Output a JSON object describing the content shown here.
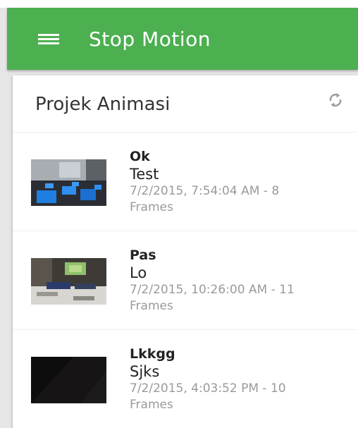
{
  "colors": {
    "app_bar": "#4caf50",
    "meta_text": "#9a9a9a",
    "icon": "#9e9e9e"
  },
  "app_bar": {
    "menu_icon": "hamburger-menu-icon",
    "title": "Stop Motion"
  },
  "card": {
    "title": "Projek Animasi",
    "refresh_icon": "refresh-icon"
  },
  "projects": [
    {
      "name": "Ok",
      "description": "Test",
      "meta_line1": "7/2/2015, 7:54:04 AM - 8",
      "meta_line2": "Frames",
      "thumbnail": "classroom-computers"
    },
    {
      "name": "Pas",
      "description": "Lo",
      "meta_line1": "7/2/2015, 10:26:00 AM - 11",
      "meta_line2": "Frames",
      "thumbnail": "classroom-projector"
    },
    {
      "name": "Lkkgg",
      "description": "Sjks",
      "meta_line1": "7/2/2015, 4:03:52 PM - 10",
      "meta_line2": "Frames",
      "thumbnail": "dark-frame"
    }
  ]
}
